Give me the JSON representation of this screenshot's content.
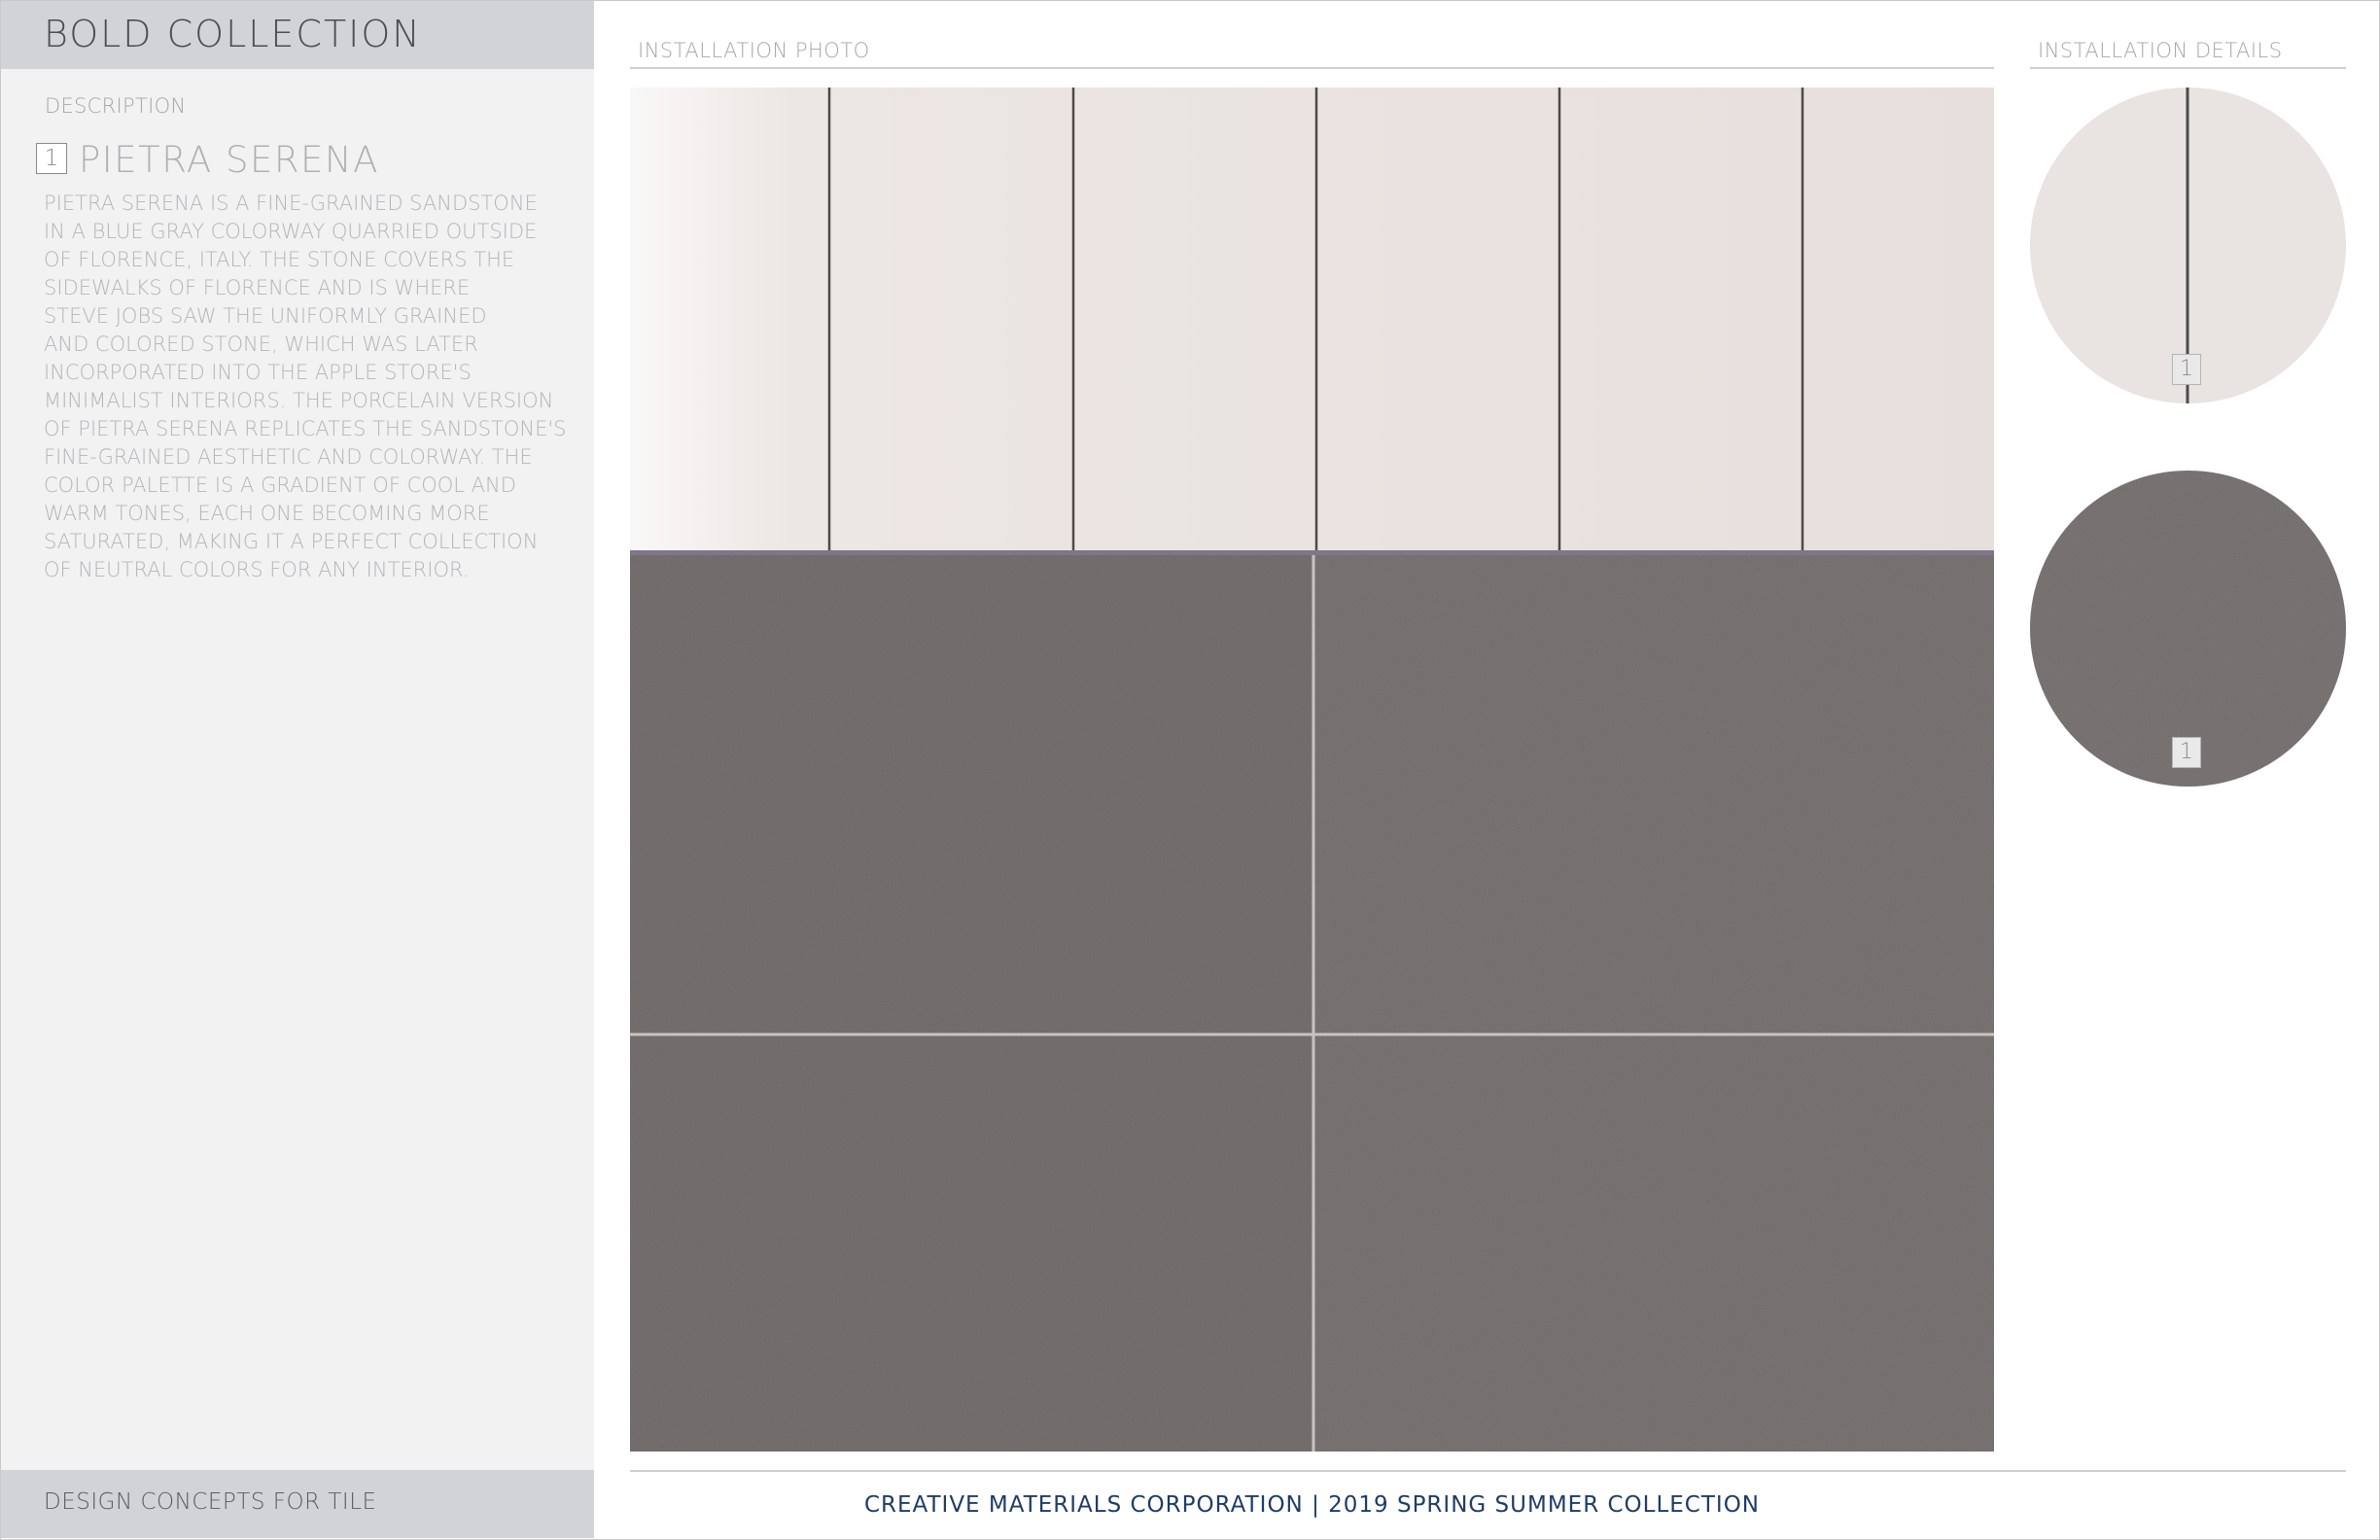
{
  "sidebar": {
    "collection_title": "BOLD COLLECTION",
    "description_label": "DESCRIPTION",
    "product_number": "1",
    "product_name": "PIETRA SERENA",
    "description_lines": [
      "PIETRA SERENA IS A FINE-GRAINED SANDSTONE",
      "IN A BLUE GRAY COLORWAY QUARRIED OUTSIDE",
      "OF FLORENCE, ITALY. THE STONE COVERS THE",
      "SIDEWALKS OF FLORENCE AND IS WHERE",
      "STEVE JOBS SAW THE UNIFORMLY GRAINED",
      "AND COLORED STONE, WHICH WAS LATER",
      "INCORPORATED INTO THE APPLE STORE'S",
      "MINIMALIST INTERIORS. THE PORCELAIN VERSION",
      "OF PIETRA SERENA REPLICATES THE SANDSTONE'S",
      "FINE-GRAINED AESTHETIC AND COLORWAY. THE",
      "COLOR PALETTE IS A GRADIENT OF COOL AND",
      "WARM TONES, EACH ONE BECOMING MORE",
      "SATURATED, MAKING IT A PERFECT COLLECTION",
      "OF NEUTRAL COLORS FOR ANY INTERIOR."
    ],
    "footer_label": "DESIGN CONCEPTS FOR TILE"
  },
  "installation_photo": {
    "label": "INSTALLATION PHOTO",
    "upper_tile_color": "#ebe5e3",
    "lower_tile_color": "#6a6564"
  },
  "installation_details": {
    "label": "INSTALLATION DETAILS",
    "details": [
      {
        "number": "1",
        "tile_color": "#e9e3e1"
      },
      {
        "number": "1",
        "tile_color": "#6a6564"
      }
    ]
  },
  "footer": {
    "text": "CREATIVE MATERIALS CORPORATION | 2019 SPRING SUMMER COLLECTION"
  },
  "colors": {
    "sidebar_bg": "#f2f2f3",
    "sidebar_band": "#d1d3d6",
    "footer_text": "#1f3c68"
  }
}
